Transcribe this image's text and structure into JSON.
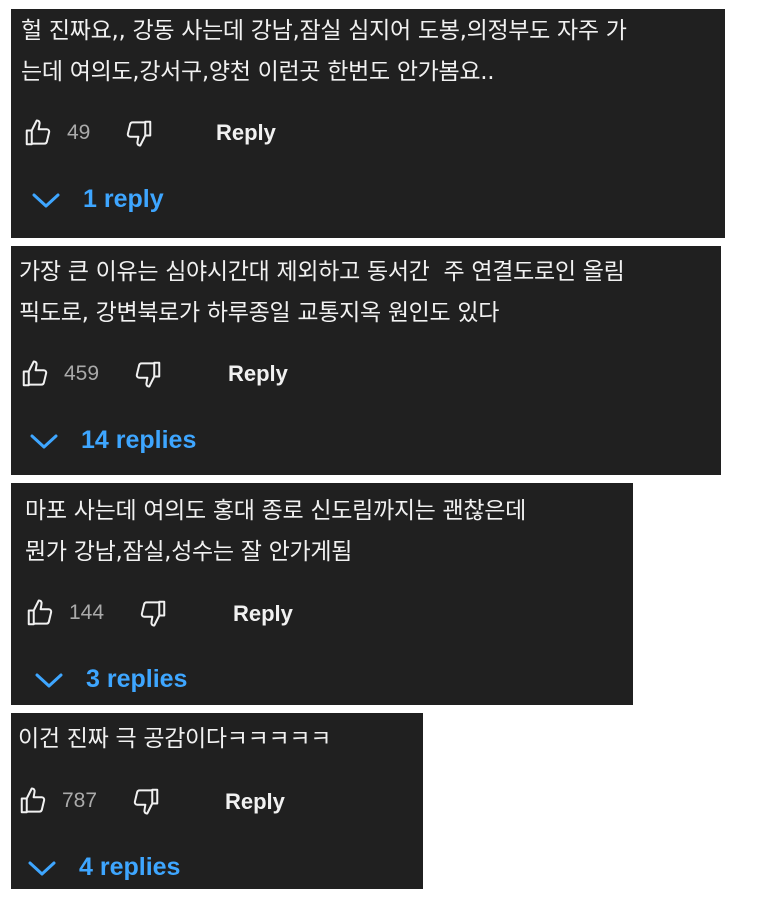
{
  "comments": [
    {
      "text": "헐 진짜요,, 강동 사는데 강남,잠실 심지어 도봉,의정부도 자주 가\n는데 여의도,강서구,양천 이런곳 한번도 안가봄요..",
      "likes": "49",
      "reply_label": "Reply",
      "replies_label": "1 reply"
    },
    {
      "text": "가장 큰 이유는 심야시간대 제외하고 동서간  주 연결도로인 올림\n픽도로, 강변북로가 하루종일 교통지옥 원인도 있다",
      "likes": "459",
      "reply_label": "Reply",
      "replies_label": "14 replies"
    },
    {
      "text": "마포 사는데 여의도 홍대 종로 신도림까지는 괜찮은데\n뭔가 강남,잠실,성수는 잘 안가게됨",
      "likes": "144",
      "reply_label": "Reply",
      "replies_label": "3 replies"
    },
    {
      "text": "이건 진짜 극 공감이다ㅋㅋㅋㅋㅋ",
      "likes": "787",
      "reply_label": "Reply",
      "replies_label": "4 replies"
    }
  ],
  "icons": {
    "like": "thumbs-up-outline-icon",
    "dislike": "thumbs-down-outline-icon",
    "expand": "chevron-down-icon"
  },
  "colors": {
    "card_background": "#202020",
    "text": "#f1f1f1",
    "count": "#aaaaaa",
    "link": "#3ea6ff"
  }
}
